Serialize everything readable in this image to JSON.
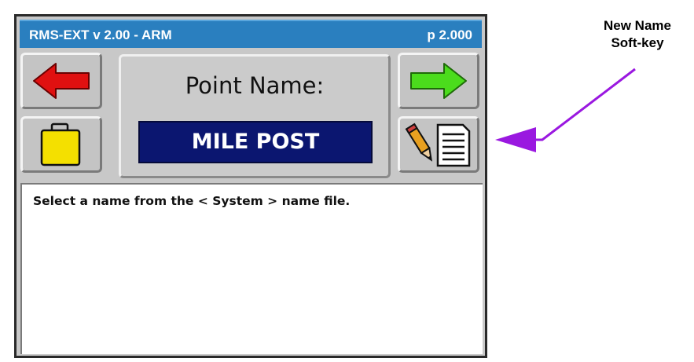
{
  "title_bar": {
    "app_title": "RMS-EXT v 2.00 - ARM",
    "page_number": "p 2.000"
  },
  "panel": {
    "label": "Point Name:",
    "value": "MILE POST"
  },
  "softkeys": {
    "back": {
      "icon": "arrow-left-icon",
      "color": "#e01010"
    },
    "forward": {
      "icon": "arrow-right-icon",
      "color": "#4bdc1c"
    },
    "folder": {
      "icon": "briefcase-icon",
      "color": "#f4e000"
    },
    "new_name": {
      "icon": "pencil-document-icon"
    }
  },
  "message": {
    "text": "Select a name from the < System > name file."
  },
  "annotation": {
    "line1": "New Name",
    "line2": "Soft-key",
    "arrow_color": "#9a18e0"
  },
  "colors": {
    "title_bar": "#2a7fbf",
    "name_box": "#0b1670",
    "screen_bg": "#c8c8c8"
  }
}
